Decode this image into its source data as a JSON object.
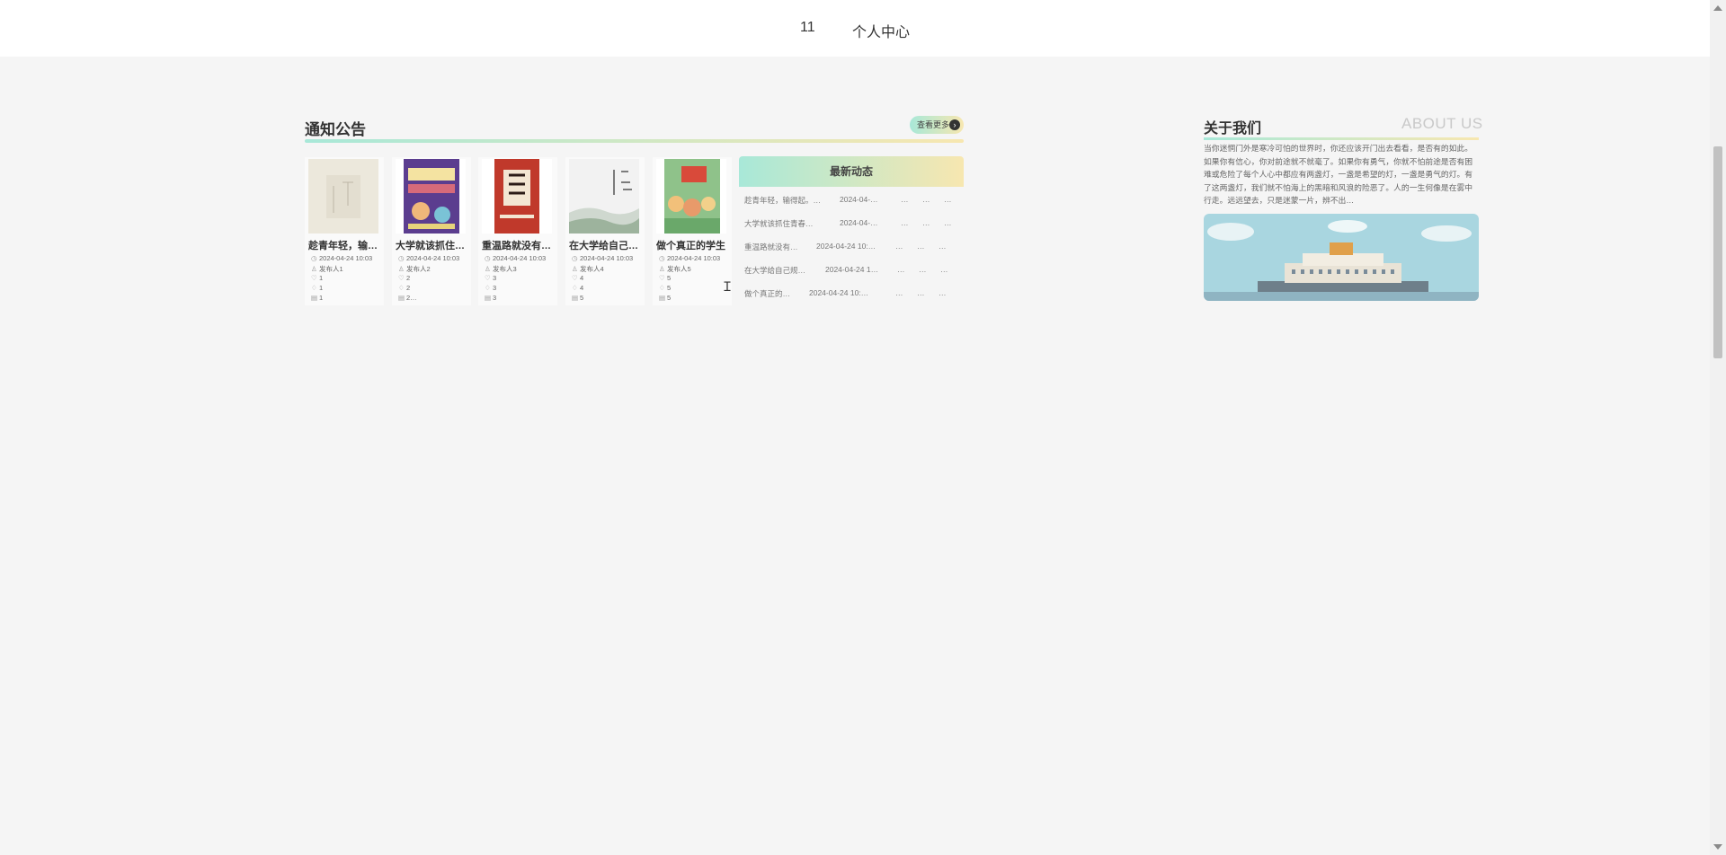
{
  "nav": {
    "items": [
      "11",
      "个人中心"
    ]
  },
  "notice": {
    "title": "通知公告",
    "more_label": "查看更多",
    "cards": [
      {
        "title": "趁青年轻，输…",
        "date": "2024-04-24 10:03",
        "publisher": "发布人1",
        "stat1": "1",
        "stat2": "1",
        "stat3": "1"
      },
      {
        "title": "大学就该抓住…",
        "date": "2024-04-24 10:03",
        "publisher": "发布人2",
        "stat1": "2",
        "stat2": "2",
        "stat3": "2…"
      },
      {
        "title": "重温路就没有…",
        "date": "2024-04-24 10:03",
        "publisher": "发布人3",
        "stat1": "3",
        "stat2": "3",
        "stat3": "3"
      },
      {
        "title": "在大学给自己…",
        "date": "2024-04-24 10:03",
        "publisher": "发布人4",
        "stat1": "4",
        "stat2": "4",
        "stat3": "5"
      },
      {
        "title": "做个真正的学生",
        "date": "2024-04-24 10:03",
        "publisher": "发布人5",
        "stat1": "5",
        "stat2": "5",
        "stat3": "5"
      }
    ]
  },
  "news": {
    "title": "最新动态",
    "rows": [
      {
        "title": "趁青年轻，输得起。…",
        "date": "2024-04-…",
        "a": "…",
        "b": "…",
        "c": "…"
      },
      {
        "title": "大学就该抓住青春…",
        "date": "2024-04-…",
        "a": "…",
        "b": "…",
        "c": "…"
      },
      {
        "title": "重温路就没有…",
        "date": "2024-04-24 10:…",
        "a": "…",
        "b": "…",
        "c": "…"
      },
      {
        "title": "在大学给自己规…",
        "date": "2024-04-24 1…",
        "a": "…",
        "b": "…",
        "c": "…"
      },
      {
        "title": "做个真正的…",
        "date": "2024-04-24 10:…",
        "a": "…",
        "b": "…",
        "c": "…"
      }
    ]
  },
  "about": {
    "title": "关于我们",
    "title_en": "ABOUT US",
    "text": "当你迷惘门外是寒冷可怕的世界时，你还应该开门出去看看，是否有的如此。如果你有信心，你对前途就不就毫了。如果你有勇气，你就不怕前途是否有困难或危险了每个人心中都应有两盏灯，一盏是希望的灯，一盏是勇气的灯。有了这两盏灯，我们就不怕海上的黑暗和风浪的险恶了。人的一生何像是在雾中行走。远远望去，只是迷蒙一片，辨不出…"
  },
  "colors": {
    "accent_start": "#a8e8d8",
    "accent_end": "#f7e7b0"
  }
}
